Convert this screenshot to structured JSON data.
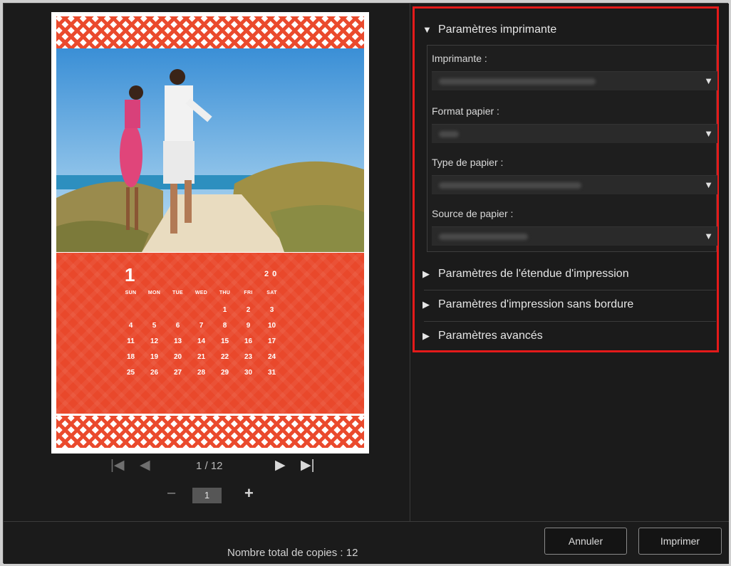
{
  "preview": {
    "calendar": {
      "month": "1",
      "year": "2 0",
      "day_names": [
        "SUN",
        "MON",
        "TUE",
        "WED",
        "THU",
        "FRI",
        "SAT"
      ],
      "days": [
        "",
        "",
        "",
        "",
        "1",
        "2",
        "3",
        "4",
        "5",
        "6",
        "7",
        "8",
        "9",
        "10",
        "11",
        "12",
        "13",
        "14",
        "15",
        "16",
        "17",
        "18",
        "19",
        "20",
        "21",
        "22",
        "23",
        "24",
        "25",
        "26",
        "27",
        "28",
        "29",
        "30",
        "31"
      ]
    },
    "pager": {
      "first": "|◀",
      "prev": "◀",
      "page": "1 / 12",
      "next": "▶",
      "last": "▶|"
    },
    "copies": {
      "minus": "–",
      "value": "1",
      "plus": "+"
    }
  },
  "settings": {
    "printer_settings": {
      "arrow": "▼",
      "label": "Paramètres imprimante"
    },
    "fields": {
      "printer": {
        "label": "Imprimante :"
      },
      "paper_size": {
        "label": "Format papier :"
      },
      "media_type": {
        "label": "Type de papier :"
      },
      "paper_source": {
        "label": "Source de papier :"
      },
      "chevron": "▼"
    },
    "print_range": {
      "arrow": "▶",
      "label": "Paramètres de l'étendue d'impression"
    },
    "borderless": {
      "arrow": "▶",
      "label": "Paramètres d'impression sans bordure"
    },
    "advanced": {
      "arrow": "▶",
      "label": "Paramètres avancés"
    }
  },
  "footer": {
    "total_copies": "Nombre total de copies : 12",
    "cancel_label": "Annuler",
    "print_label": "Imprimer"
  },
  "colors": {
    "accent_red": "#e41a1a",
    "calendar_orange": "#e9482b",
    "background": "#1b1b1b"
  }
}
